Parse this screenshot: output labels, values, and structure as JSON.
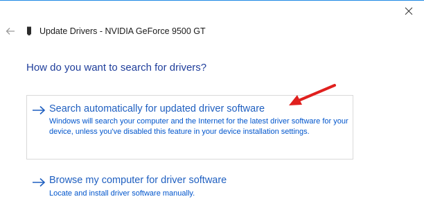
{
  "window": {
    "title": "Update Drivers - NVIDIA GeForce 9500 GT",
    "icons": {
      "close": "close-icon",
      "back": "back-arrow-icon",
      "device": "device-icon"
    }
  },
  "main": {
    "heading": "How do you want to search for drivers?",
    "options": [
      {
        "title": "Search automatically for updated driver software",
        "description": "Windows will search your computer and the Internet for the latest driver software for your device, unless you've disabled this feature in your device installation settings.",
        "icon": "arrow-right-icon"
      },
      {
        "title": "Browse my computer for driver software",
        "description": "Locate and install driver software manually.",
        "icon": "arrow-right-icon"
      }
    ]
  },
  "colors": {
    "accent": "#1f5fc0",
    "heading": "#1f3e9b",
    "annotation": "#e0201e"
  }
}
